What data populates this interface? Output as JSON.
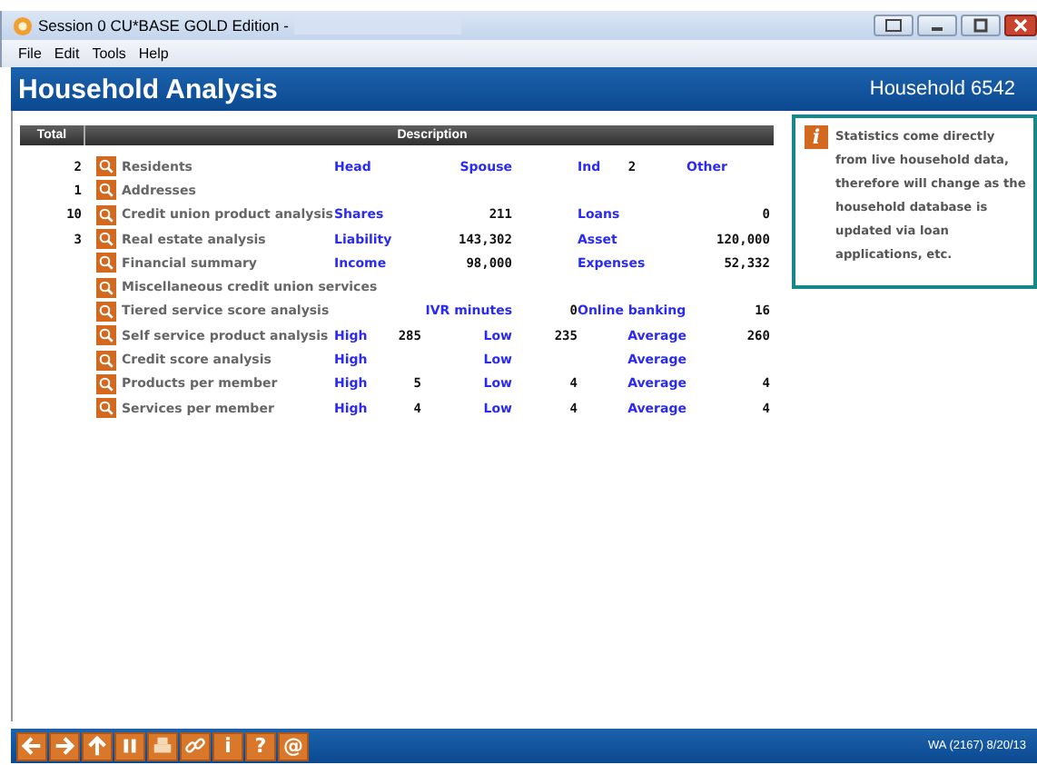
{
  "window": {
    "title": "Session 0 CU*BASE GOLD Edition -"
  },
  "menu": [
    "File",
    "Edit",
    "Tools",
    "Help"
  ],
  "header": {
    "title": "Household Analysis",
    "household": "Household 6542"
  },
  "table": {
    "columns": [
      "Total",
      "Description"
    ],
    "rows": [
      {
        "total": "2",
        "description": "Residents",
        "kind": "household",
        "stats": [
          {
            "label": "Head"
          },
          {
            "label": "Spouse"
          },
          {
            "label": "Ind",
            "value": "2"
          },
          {
            "label": "Other"
          }
        ]
      },
      {
        "total": "1",
        "description": "Addresses",
        "kind": "none"
      },
      {
        "total": "10",
        "description": "Credit union product analysis",
        "kind": "pairs",
        "stats": [
          {
            "label": "Shares",
            "value": "211"
          },
          {
            "label": "Loans",
            "value": "0"
          }
        ]
      },
      {
        "total": "3",
        "description": "Real estate analysis",
        "kind": "pairs",
        "stats": [
          {
            "label": "Liability",
            "value": "143,302"
          },
          {
            "label": "Asset",
            "value": "120,000"
          }
        ]
      },
      {
        "description": "Financial summary",
        "kind": "pairs",
        "stats": [
          {
            "label": "Income",
            "value": "98,000"
          },
          {
            "label": "Expenses",
            "value": "52,332"
          }
        ]
      },
      {
        "description": "Miscellaneous credit union services",
        "kind": "none"
      },
      {
        "description": "Tiered service score analysis",
        "kind": "tiered",
        "stats": [
          {
            "label": "IVR minutes",
            "value": "0"
          },
          {
            "label": "Online banking",
            "value": "16"
          }
        ]
      },
      {
        "description": "Self service product analysis",
        "kind": "levels",
        "stats": [
          {
            "label": "High",
            "value": "285"
          },
          {
            "label": "Low",
            "value": "235"
          },
          {
            "label": "Average",
            "value": "260"
          }
        ]
      },
      {
        "description": "Credit score analysis",
        "kind": "levels",
        "stats": [
          {
            "label": "High"
          },
          {
            "label": "Low"
          },
          {
            "label": "Average"
          }
        ]
      },
      {
        "description": "Products per member",
        "kind": "levels",
        "stats": [
          {
            "label": "High",
            "value": "5"
          },
          {
            "label": "Low",
            "value": "4"
          },
          {
            "label": "Average",
            "value": "4"
          }
        ]
      },
      {
        "description": "Services per member",
        "kind": "levels",
        "stats": [
          {
            "label": "High",
            "value": "4"
          },
          {
            "label": "Low",
            "value": "4"
          },
          {
            "label": "Average",
            "value": "4"
          }
        ]
      }
    ]
  },
  "info": {
    "icon": "i",
    "text": "Statistics come directly from live household data, therefore will change as the household database is updated via loan applications, etc."
  },
  "toolbar": [
    {
      "kind": "back"
    },
    {
      "kind": "forward"
    },
    {
      "kind": "up"
    },
    {
      "kind": "pause"
    },
    {
      "kind": "print"
    },
    {
      "kind": "link"
    },
    {
      "kind": "glyph",
      "text": "i"
    },
    {
      "kind": "glyph",
      "text": "?"
    },
    {
      "kind": "glyph",
      "text": "@"
    }
  ],
  "status": "WA (2167) 8/20/13"
}
